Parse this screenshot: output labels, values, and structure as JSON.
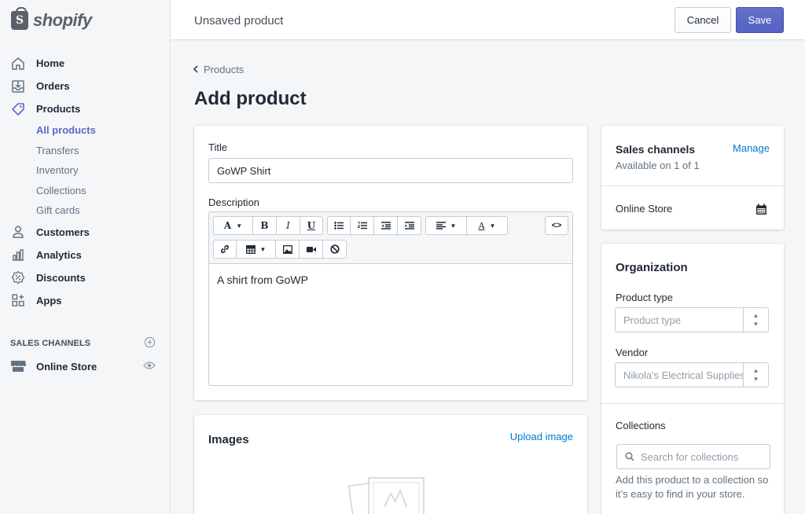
{
  "brand": {
    "logo_letter": "S",
    "name": "shopify"
  },
  "topbar": {
    "title": "Unsaved product",
    "cancel_label": "Cancel",
    "save_label": "Save"
  },
  "nav": {
    "home": "Home",
    "orders": "Orders",
    "products": "Products",
    "sub_items": [
      "All products",
      "Transfers",
      "Inventory",
      "Collections",
      "Gift cards"
    ],
    "customers": "Customers",
    "analytics": "Analytics",
    "discounts": "Discounts",
    "apps": "Apps"
  },
  "sales_channels": {
    "heading": "SALES CHANNELS",
    "online_store": "Online Store"
  },
  "breadcrumb": {
    "label": "Products"
  },
  "page_title": "Add product",
  "product_form": {
    "title_label": "Title",
    "title_value": "GoWP Shirt",
    "description_label": "Description",
    "description_value": "A shirt from GoWP"
  },
  "images": {
    "heading": "Images",
    "upload_label": "Upload image"
  },
  "sales_card": {
    "heading": "Sales channels",
    "manage_label": "Manage",
    "availability": "Available on 1 of 1",
    "channel": "Online Store"
  },
  "organization": {
    "heading": "Organization",
    "product_type_label": "Product type",
    "product_type_placeholder": "Product type",
    "vendor_label": "Vendor",
    "vendor_value": "Nikola's Electrical Supplies",
    "collections_label": "Collections",
    "collections_placeholder": "Search for collections",
    "collections_help": "Add this product to a collection so it’s easy to find in your store."
  },
  "colors": {
    "accent": "#5c6ac4",
    "link": "#007ace",
    "background": "#f4f6f8"
  }
}
